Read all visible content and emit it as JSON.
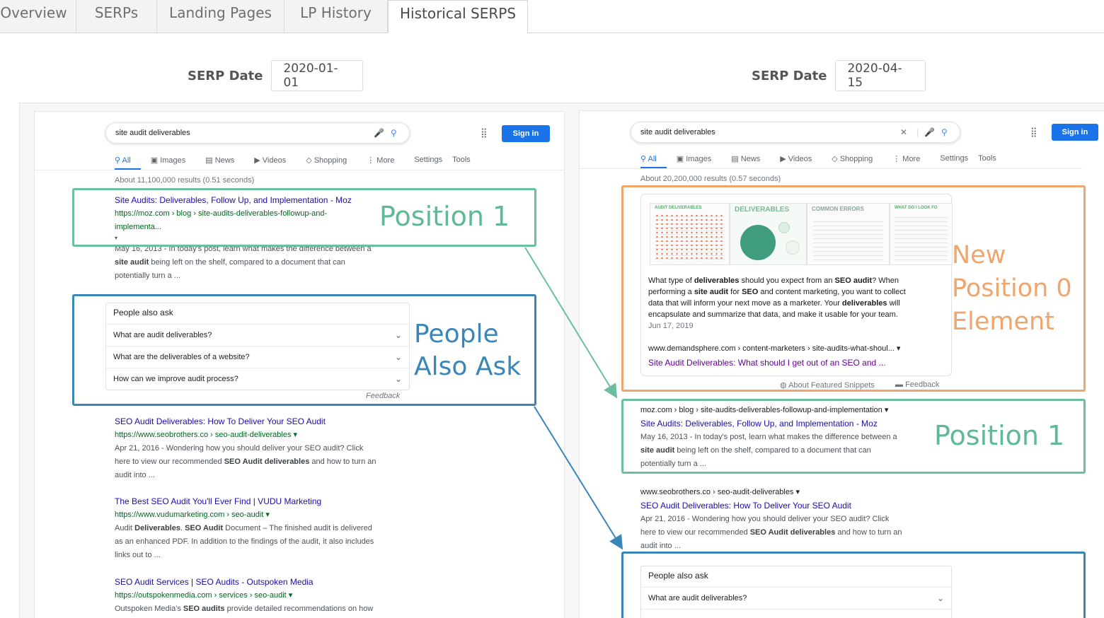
{
  "tabs": [
    "Overview",
    "SERPs",
    "Landing Pages",
    "LP History",
    "Historical SERPS"
  ],
  "active_tab": "Historical SERPS",
  "left": {
    "serp_date_label": "SERP Date",
    "serp_date": "2020-01-01",
    "query": "site audit deliverables",
    "signin": "Sign in",
    "nav": [
      "All",
      "Images",
      "News",
      "Videos",
      "Shopping",
      "More",
      "Settings",
      "Tools"
    ],
    "result_count": "About 11,100,000 results (0.51 seconds)",
    "r1": {
      "title": "Site Audits: Deliverables, Follow Up, and Implementation - Moz",
      "url_line1": "https://moz.com › blog › site-audits-deliverables-followup-and-",
      "url_line2": "implementa...",
      "snippet_line1": "May 16, 2013 - In today's post, learn what makes the difference between a",
      "snippet_bold": "site audit",
      "snippet_line2": " being left on the shelf, compared to a document that can",
      "snippet_line3": "potentially turn a ..."
    },
    "paa": {
      "heading": "People also ask",
      "questions": [
        "What are audit deliverables?",
        "What are the deliverables of a website?",
        "How can we improve audit process?"
      ],
      "feedback": "Feedback"
    },
    "r2": {
      "title": "SEO Audit Deliverables: How To Deliver Your SEO Audit",
      "url": "https://www.seobrothers.co › seo-audit-deliverables ▾",
      "line1": "Apr 21, 2016 - Wondering how you should deliver your SEO audit? Click",
      "line2a": "here to view our recommended ",
      "line2b": "SEO Audit deliverables",
      "line2c": " and how to turn an",
      "line3": "audit into ..."
    },
    "r3": {
      "title": "The Best SEO Audit You'll Ever Find | VUDU Marketing",
      "url": "https://www.vudumarketing.com › seo-audit ▾",
      "line1a": "Audit ",
      "line1b": "Deliverables",
      "line1c": ". ",
      "line1d": "SEO Audit",
      "line1e": " Document – The finished audit is delivered",
      "line2": "as an enhanced PDF. In addition to the findings of the audit, it also includes",
      "line3": "links out to ..."
    },
    "r4": {
      "title": "SEO Audit Services | SEO Audits - Outspoken Media",
      "url": "https://outspokenmedia.com › services › seo-audit ▾",
      "line1a": "Outspoken Media's ",
      "line1b": "SEO audits",
      "line1c": " provide detailed recommendations on how"
    }
  },
  "right": {
    "serp_date_label": "SERP Date",
    "serp_date": "2020-04-15",
    "query": "site audit deliverables",
    "signin": "Sign in",
    "nav": [
      "All",
      "Images",
      "News",
      "Videos",
      "Shopping",
      "More",
      "Settings",
      "Tools"
    ],
    "result_count": "About 20,200,000 results (0.57 seconds)",
    "featured": {
      "thumb_titles": [
        "AUDIT DELIVERABLES",
        "DELIVERABLES",
        "COMMON ERRORS",
        "WHAT DO I LOOK FO"
      ],
      "text1a": "What type of ",
      "text1b": "deliverables",
      "text1c": " should you expect from an ",
      "text1d": "SEO audit",
      "text1e": "? When",
      "text2a": "performing a ",
      "text2b": "site audit",
      "text2c": " for ",
      "text2d": "SEO",
      "text2e": " and content marketing, you want to collect",
      "text3a": "data that will inform your next move as a marketer. Your ",
      "text3b": "deliverables",
      "text3c": " will",
      "text4": "encapsulate and summarize that data, and make it usable for your team.",
      "date": "Jun 17, 2019",
      "url": "www.demandsphere.com › content-marketers › site-audits-what-shoul... ▾",
      "title": "Site Audit Deliverables: What should I get out of an SEO and ...",
      "about": "About Featured Snippets",
      "feedback": "Feedback"
    },
    "r1": {
      "url": "moz.com › blog › site-audits-deliverables-followup-and-implementation ▾",
      "title": "Site Audits: Deliverables, Follow Up, and Implementation - Moz",
      "line1": "May 16, 2013 - In today's post, learn what makes the difference between a",
      "line2a": "site audit",
      "line2b": " being left on the shelf, compared to a document that can",
      "line3": "potentially turn a ..."
    },
    "r2": {
      "url": "www.seobrothers.co › seo-audit-deliverables ▾",
      "title": "SEO Audit Deliverables: How To Deliver Your SEO Audit",
      "line1": "Apr 21, 2016 - Wondering how you should deliver your SEO audit? Click",
      "line2a": "here to view our recommended ",
      "line2b": "SEO Audit deliverables",
      "line2c": " and how to turn an",
      "line3": "audit into ..."
    },
    "paa": {
      "heading": "People also ask",
      "questions": [
        "What are audit deliverables?"
      ]
    }
  },
  "annotations": {
    "left_pos1": "Position 1",
    "left_paa_line1": "People",
    "left_paa_line2": "Also Ask",
    "right_new_line1": "New",
    "right_new_line2": "Position 0",
    "right_new_line3": "Element",
    "right_pos1": "Position 1"
  },
  "colors": {
    "green": "#5fb995",
    "blue": "#3b86b8",
    "orange": "#f0a56c",
    "google_blue": "#1a73e8",
    "link": "#1a0dab"
  }
}
